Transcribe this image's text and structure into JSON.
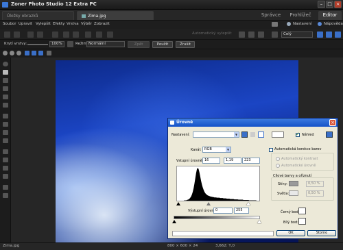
{
  "window": {
    "title": "Zoner Photo Studio 12 Extra PC"
  },
  "tabs": {
    "documents": [
      {
        "label": "Úložky obrazků"
      },
      {
        "label": "Zima.jpg"
      }
    ],
    "modes": [
      {
        "label": "Správce"
      },
      {
        "label": "Prohlížeč"
      },
      {
        "label": "Editor"
      }
    ]
  },
  "menu": [
    "Soubor",
    "Upravit",
    "Vylepšit",
    "Efekty",
    "Vrstva",
    "Výběr",
    "Zobrazit"
  ],
  "menu_right": {
    "settings": "Nastavení",
    "help": "Nápověda"
  },
  "toolbar1": {
    "auto_enhance": "Automatický vylepšit",
    "color_mode": "Celý"
  },
  "toolbar2": {
    "opacity_label": "Krytí vrstvy:",
    "opacity_value": "100%",
    "mode_label": "Režim:",
    "mode_value": "Normální",
    "disabled_btn": "Zpět",
    "apply": "Použít",
    "cancel": "Zrušit"
  },
  "status": {
    "filename": "Zima.jpg",
    "dimensions": "800 × 600 × 24",
    "coords": "3,662: Y,0"
  },
  "dialog": {
    "title": "Úrovně",
    "preset_label": "Nastavení:",
    "preset_value": "",
    "preview_label": "Náhled",
    "channel_label": "Kanál:",
    "channel_value": "RGB",
    "input_levels_label": "Vstupní úrovně:",
    "input_black": "16",
    "input_gamma": "1,19",
    "input_white": "223",
    "output_levels_label": "Výstupní úrovně:",
    "output_black": "0",
    "output_white": "255",
    "auto_color_label": "Automatická korekce barev",
    "auto_contrast": "Automatický kontrast",
    "auto_levels": "Automatické úrovně",
    "target_group": "Cílové barvy a oříznutí",
    "shadows_label": "Stíny:",
    "shadows_value": "0,50 %",
    "highlights_label": "Světla:",
    "highlights_value": "0,50 %",
    "black_point": "Černý bod:",
    "white_point": "Bílý bod:",
    "ok": "OK",
    "cancel": "Storno"
  },
  "histogram": [
    0,
    0,
    0,
    0,
    0,
    0,
    0,
    0,
    0,
    1,
    1,
    1,
    2,
    3,
    4,
    6,
    9,
    13,
    19,
    27,
    38,
    52,
    68,
    84,
    96,
    100,
    96,
    86,
    73,
    60,
    49,
    40,
    33,
    27,
    23,
    20,
    18,
    16,
    15,
    14,
    13,
    12,
    12,
    11,
    11,
    10,
    10,
    10,
    9,
    9,
    9,
    9,
    8,
    8,
    8,
    8,
    7,
    7,
    7,
    7,
    6,
    6,
    6,
    6,
    5,
    5,
    5,
    5,
    5,
    4,
    4,
    4,
    4,
    4,
    3,
    3,
    3,
    3,
    3,
    3,
    2,
    2,
    2,
    2,
    2,
    2,
    2,
    1,
    1,
    1,
    1,
    1,
    1,
    1,
    1,
    1,
    0,
    0,
    0,
    0
  ],
  "colors": {
    "accent": "#1452c8",
    "dialog_bg": "#ece9d8",
    "app_bg": "#1f1f1f"
  }
}
